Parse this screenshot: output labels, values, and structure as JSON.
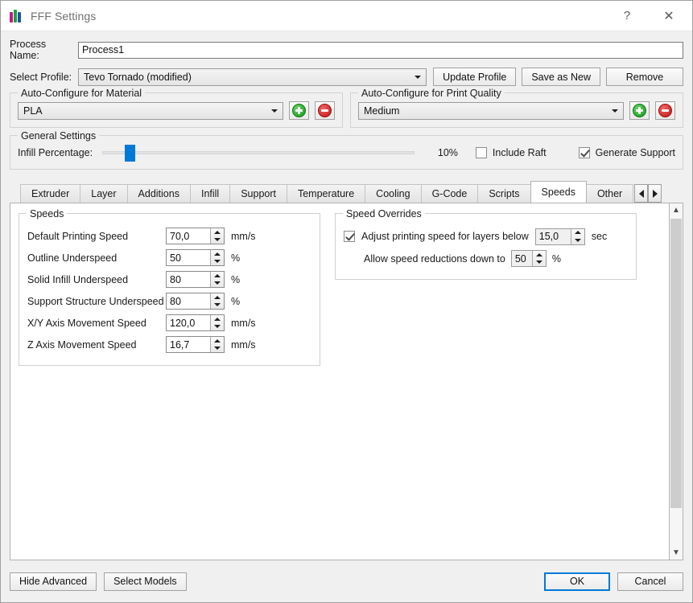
{
  "window": {
    "title": "FFF Settings",
    "app_icon": "simplify3d-logo-icon",
    "help_label": "?",
    "close_label": "✕"
  },
  "form": {
    "process_name_label": "Process Name:",
    "process_name_value": "Process1",
    "select_profile_label": "Select Profile:",
    "select_profile_value": "Tevo Tornado (modified)",
    "update_profile_label": "Update Profile",
    "save_as_new_label": "Save as New",
    "remove_label": "Remove"
  },
  "auto_material": {
    "title": "Auto-Configure for Material",
    "value": "PLA",
    "add_label": "+",
    "remove_label": "−"
  },
  "auto_quality": {
    "title": "Auto-Configure for Print Quality",
    "value": "Medium",
    "add_label": "+",
    "remove_label": "−"
  },
  "general": {
    "title": "General Settings",
    "infill_label": "Infill Percentage:",
    "infill_value": "10%",
    "infill_percent": 10,
    "include_raft_label": "Include Raft",
    "include_raft_checked": false,
    "generate_support_label": "Generate Support",
    "generate_support_checked": true
  },
  "tabs": {
    "items": [
      {
        "label": "Extruder",
        "active": false
      },
      {
        "label": "Layer",
        "active": false
      },
      {
        "label": "Additions",
        "active": false
      },
      {
        "label": "Infill",
        "active": false
      },
      {
        "label": "Support",
        "active": false
      },
      {
        "label": "Temperature",
        "active": false
      },
      {
        "label": "Cooling",
        "active": false
      },
      {
        "label": "G-Code",
        "active": false
      },
      {
        "label": "Scripts",
        "active": false
      },
      {
        "label": "Speeds",
        "active": true
      },
      {
        "label": "Other",
        "active": false
      }
    ],
    "scroll_left": "◀",
    "scroll_right": "▶"
  },
  "speeds": {
    "title": "Speeds",
    "rows": [
      {
        "label": "Default Printing Speed",
        "value": "70,0",
        "unit": "mm/s"
      },
      {
        "label": "Outline Underspeed",
        "value": "50",
        "unit": "%"
      },
      {
        "label": "Solid Infill Underspeed",
        "value": "80",
        "unit": "%"
      },
      {
        "label": "Support Structure Underspeed",
        "value": "80",
        "unit": "%"
      },
      {
        "label": "X/Y Axis Movement Speed",
        "value": "120,0",
        "unit": "mm/s"
      },
      {
        "label": "Z Axis Movement Speed",
        "value": "16,7",
        "unit": "mm/s"
      }
    ]
  },
  "speed_overrides": {
    "title": "Speed Overrides",
    "adjust_label": "Adjust printing speed for layers below",
    "adjust_checked": true,
    "adjust_value": "15,0",
    "adjust_unit": "sec",
    "reduction_label": "Allow speed reductions down to",
    "reduction_value": "50",
    "reduction_unit": "%"
  },
  "scrollbar": {
    "up_label": "⌃",
    "down_label": "⌄"
  },
  "footer": {
    "hide_advanced_label": "Hide Advanced",
    "select_models_label": "Select Models",
    "ok_label": "OK",
    "cancel_label": "Cancel"
  },
  "colors": {
    "accent_blue": "#0078d7",
    "add_green": "#169a16",
    "remove_red": "#c41414",
    "window_bg": "#f0f0f0",
    "panel_bg": "#ffffff"
  }
}
